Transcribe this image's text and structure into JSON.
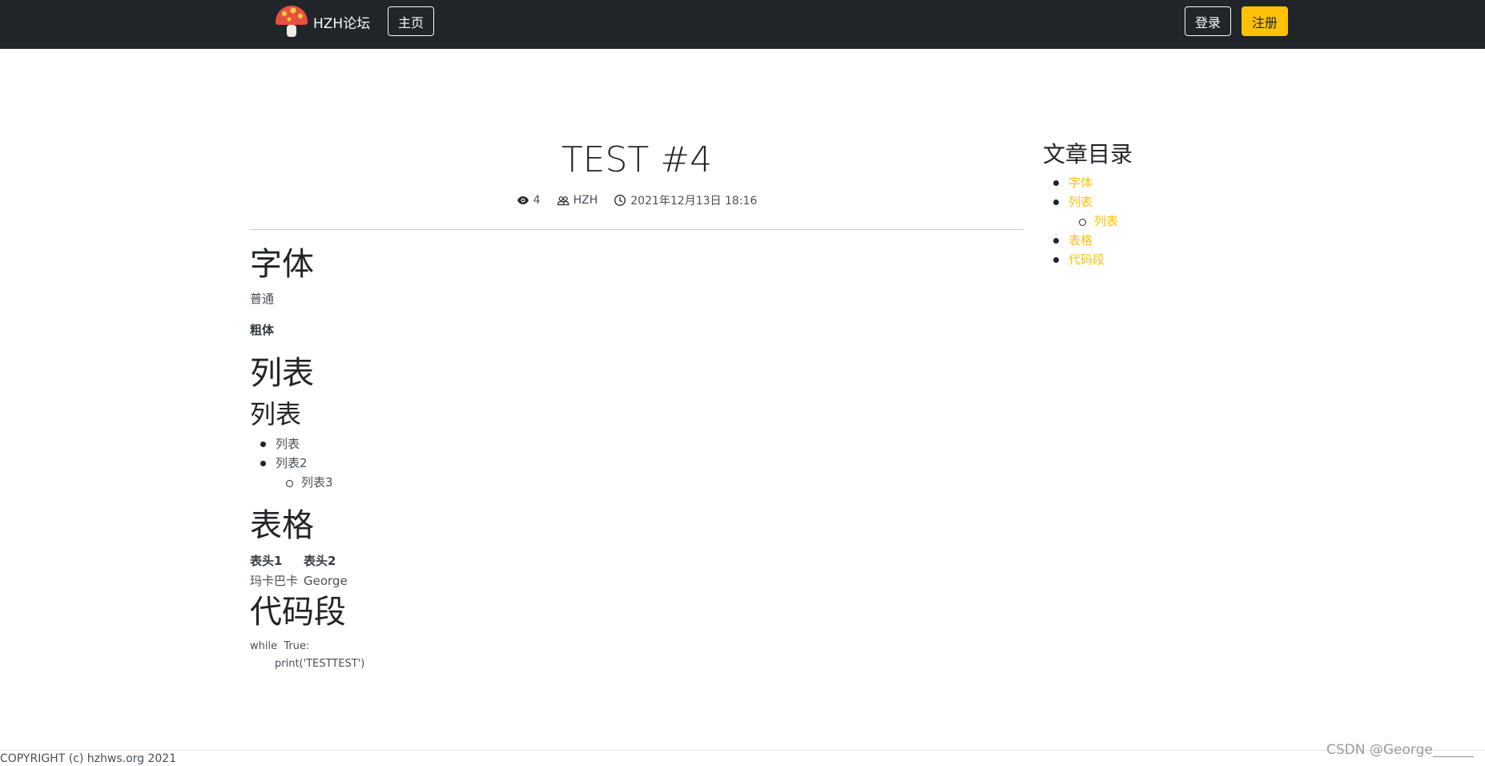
{
  "navbar": {
    "brand": "HZH论坛",
    "home": "主页",
    "login": "登录",
    "register": "注册"
  },
  "post": {
    "title": "TEST #4",
    "views": "4",
    "author": "HZH",
    "date": "2021年12月13日 18:16"
  },
  "content": {
    "font_heading": "字体",
    "normal": "普通",
    "bold": "粗体",
    "list_heading": "列表",
    "list_subheading": "列表",
    "list_items": [
      "列表",
      "列表2"
    ],
    "list_sub_items": [
      "列表3"
    ],
    "table_heading": "表格",
    "table_headers": [
      "表头1",
      "表头2"
    ],
    "table_row": [
      "玛卡巴卡",
      "George"
    ],
    "code_heading": "代码段",
    "code_lines": [
      "while  True:",
      "print('TESTTEST')"
    ]
  },
  "toc": {
    "title": "文章目录",
    "items": [
      "字体",
      "列表",
      "列表",
      "表格",
      "代码段"
    ]
  },
  "footer": {
    "copyright": "COPYRIGHT (c) hzhws.org 2021",
    "watermark": "CSDN @George______"
  },
  "colors": {
    "navbar": "#212529",
    "accent": "#ffc107"
  }
}
